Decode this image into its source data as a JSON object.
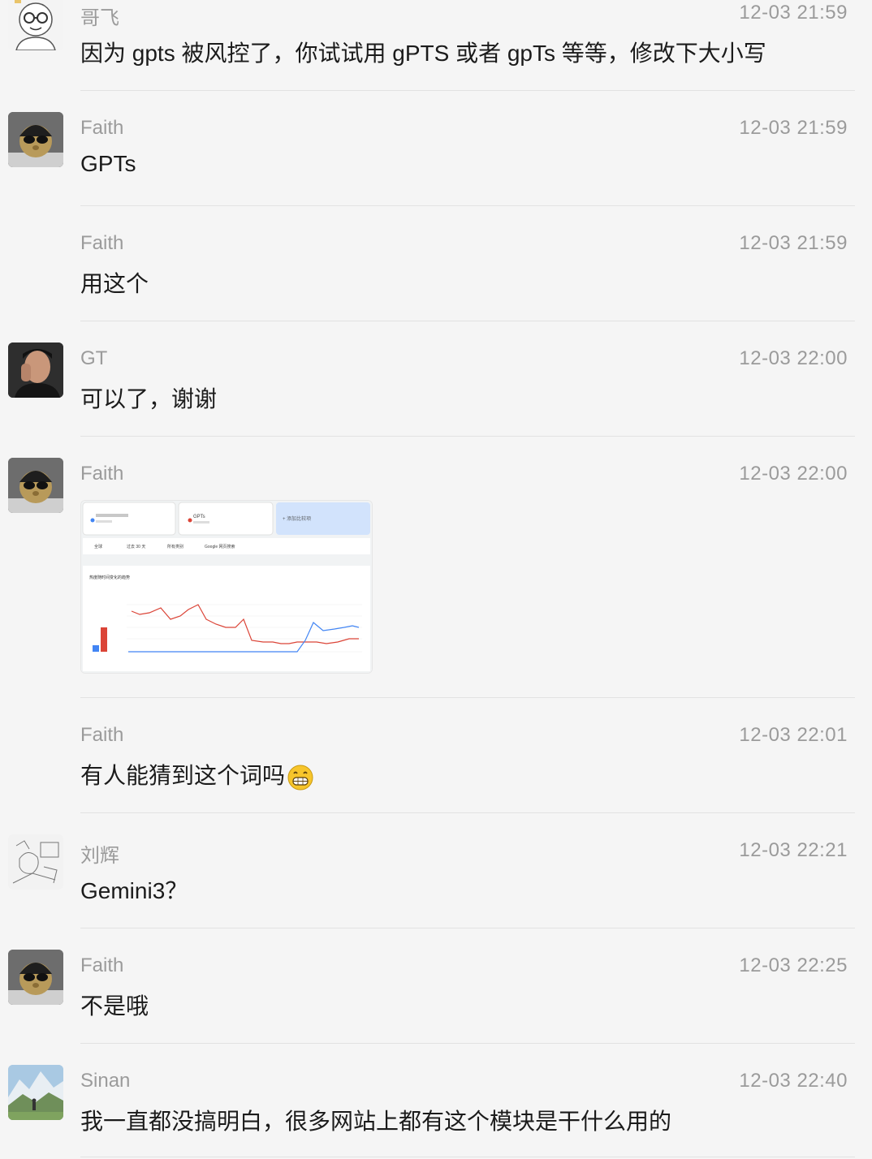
{
  "messages": [
    {
      "sender": "哥飞",
      "time": "12-03 21:59",
      "text": "因为 gpts 被风控了，你试试用 gPTS 或者 gpTs 等等，修改下大小写"
    },
    {
      "sender": "Faith",
      "time": "12-03 21:59",
      "text": "GPTs"
    },
    {
      "sender": "Faith",
      "time": "12-03 21:59",
      "text": "用这个"
    },
    {
      "sender": "GT",
      "time": "12-03 22:00",
      "text": "可以了，谢谢"
    },
    {
      "sender": "Faith",
      "time": "12-03 22:00",
      "text": ""
    },
    {
      "sender": "Faith",
      "time": "12-03 22:01",
      "text": "有人能猜到这个词吗"
    },
    {
      "sender": "刘辉",
      "time": "12-03 22:21",
      "text": "Gemini3？"
    },
    {
      "sender": "Faith",
      "time": "12-03 22:25",
      "text": "不是哦"
    },
    {
      "sender": "Sinan",
      "time": "12-03 22:40",
      "text": "我一直都没搞明白，很多网站上都有这个模块是干什么用的"
    }
  ],
  "image_preview": {
    "tab2_label": "GPTs",
    "add_compare_label": "+ 添加比较项",
    "filters": [
      "全球",
      "过去 30 天",
      "所有类别",
      "Google 网页搜索"
    ],
    "chart_title": "热度随时间变化的趋势"
  },
  "colors": {
    "series_red": "#db4437",
    "series_blue": "#4285f4",
    "accent_tab": "#d2e3fc"
  }
}
